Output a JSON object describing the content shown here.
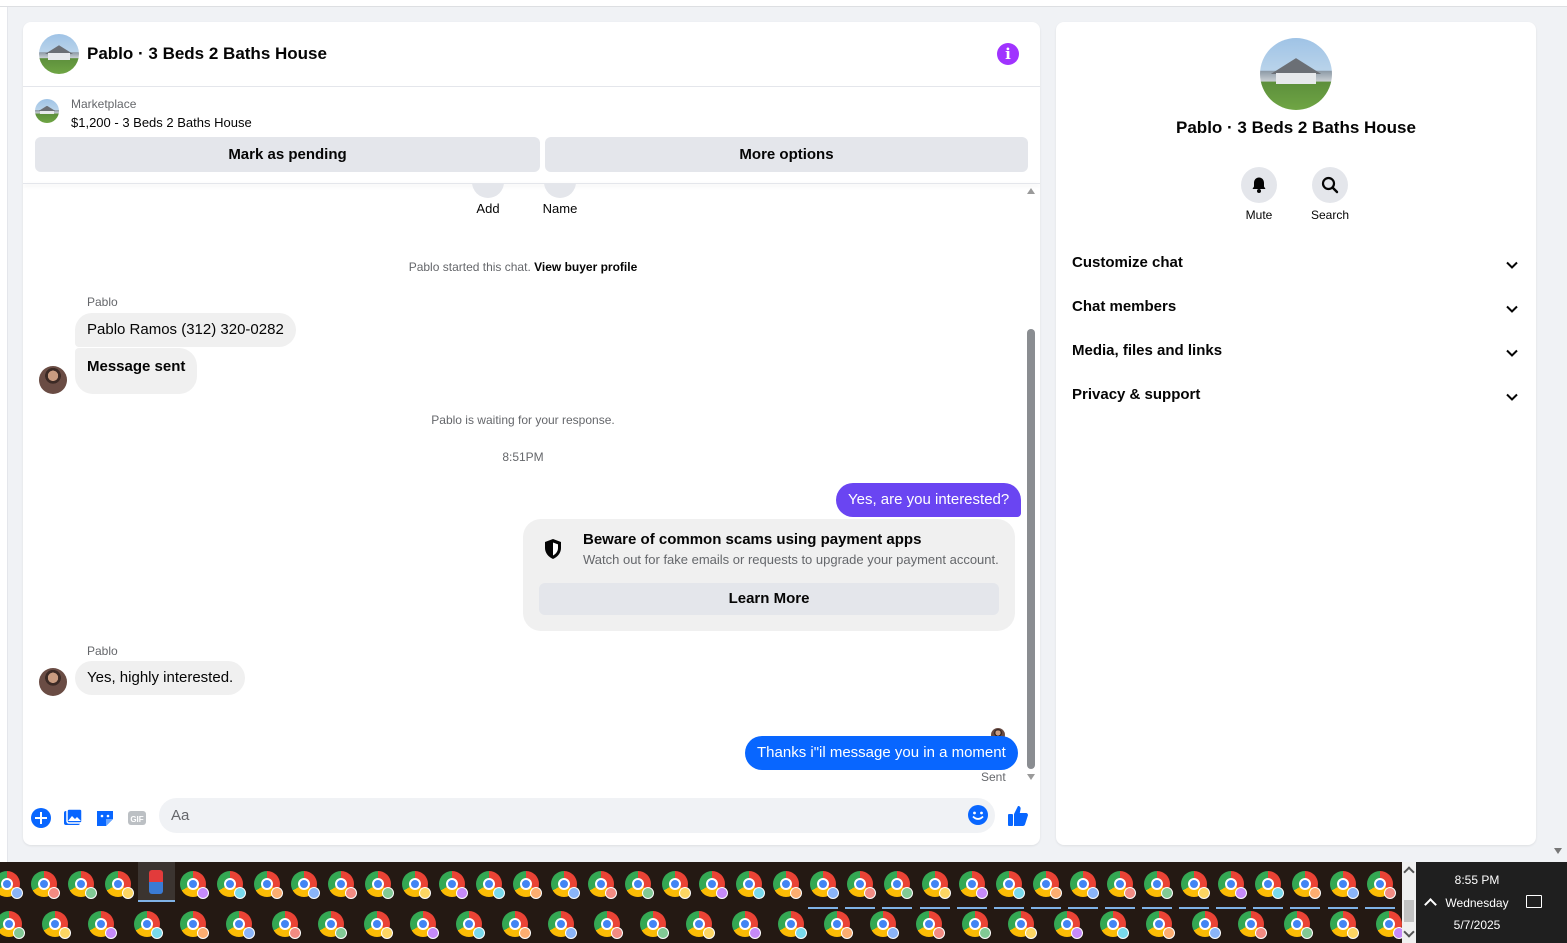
{
  "chat": {
    "title": "Pablo · 3 Beds 2 Baths House",
    "info_icon": "info-icon",
    "marketplace": {
      "label": "Marketplace",
      "item": "$1,200 - 3 Beds 2 Baths House",
      "mark_pending_label": "Mark as pending",
      "more_options_label": "More options"
    },
    "top_actions": {
      "add_label": "Add",
      "name_label": "Name"
    },
    "system": {
      "started": "Pablo started this chat.",
      "view_profile": "View buyer profile",
      "waiting": "Pablo is waiting for your response.",
      "time": "8:51PM"
    },
    "messages": {
      "sender_1": "Pablo",
      "in_1": "Pablo Ramos (312) 320-0282",
      "in_2": "Message sent",
      "out_1": "Yes, are you interested?",
      "sender_2": "Pablo",
      "in_3": "Yes, highly interested.",
      "out_2": "Thanks i\"il message you in a moment",
      "sent_status": "Sent"
    },
    "scam_card": {
      "title": "Beware of common scams using payment apps",
      "subtitle": "Watch out for fake emails or requests to upgrade your payment account.",
      "learn_more": "Learn More"
    },
    "composer": {
      "placeholder": "Aa"
    }
  },
  "sidebar": {
    "title": "Pablo · 3 Beds 2 Baths House",
    "mute_label": "Mute",
    "search_label": "Search",
    "sections": {
      "customize": "Customize chat",
      "members": "Chat members",
      "media": "Media, files and links",
      "privacy": "Privacy & support"
    }
  },
  "taskbar": {
    "time": "8:55 PM",
    "day": "Wednesday",
    "date": "5/7/2025"
  },
  "colors": {
    "outgoing_purple": "#6a45f2",
    "outgoing_blue": "#0866ff",
    "accent_blue": "#0866ff",
    "info_purple": "#a033ff"
  }
}
